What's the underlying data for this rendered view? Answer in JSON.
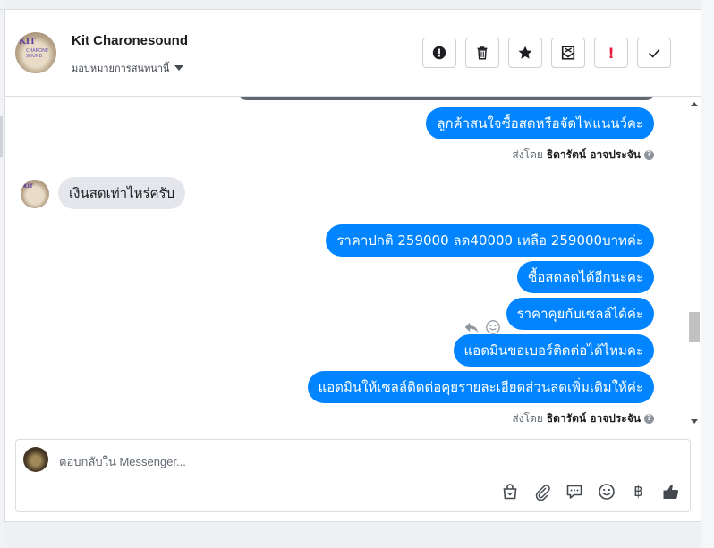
{
  "header": {
    "contact_name": "Kit Charonesound",
    "assign_label": "มอบหมายการสนทนานี้",
    "avatar_text": "KIT",
    "avatar_subtext": "CHARONE SOUND",
    "toolbar": {
      "spam": "exclamation-circle-icon",
      "delete": "trash-icon",
      "star": "star-icon",
      "archive": "archive-icon",
      "follow_up": "!",
      "done": "check-icon"
    }
  },
  "conversation": {
    "messages": [
      {
        "direction": "out",
        "text": "ลูกค้าสนใจซื้อสดหรือจัดไฟแนนว์คะ"
      },
      {
        "direction": "in",
        "text": "เงินสดเท่าไหร่ครับ"
      },
      {
        "direction": "out",
        "text": "ราคาปกติ 259000 ลด40000 เหลือ 259000บาทค่ะ"
      },
      {
        "direction": "out",
        "text": "ซื้อสดลดได้อีกนะคะ"
      },
      {
        "direction": "out",
        "text": "ราคาคุยกับเซลล์ได้ค่ะ"
      },
      {
        "direction": "out",
        "text": "แอดมินขอเบอร์ติดต่อได้ไหมคะ"
      },
      {
        "direction": "out",
        "text": "แอดมินให้เซลล์ติดต่อคุยรายละเอียดส่วนลดเพิ่มเติมให้ค่ะ"
      }
    ],
    "sent_by_prefix": "ส่งโดย",
    "sent_by_name": "ธิดารัตน์ อาจประจัน",
    "help_glyph": "?"
  },
  "composer": {
    "placeholder": "ตอบกลับใน Messenger...",
    "value": "",
    "baht_symbol": "฿"
  },
  "colors": {
    "accent": "#0084ff",
    "incoming_bubble": "#e4e6eb"
  }
}
